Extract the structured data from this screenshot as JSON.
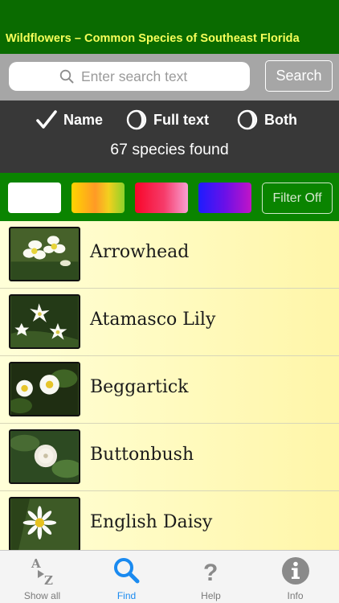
{
  "header": {
    "title": "Wildflowers – Common Species of Southeast Florida"
  },
  "search": {
    "placeholder": "Enter search text",
    "value": "",
    "button_label": "Search"
  },
  "options": {
    "items": [
      {
        "label": "Name",
        "selected": true
      },
      {
        "label": "Full text",
        "selected": false
      },
      {
        "label": "Both",
        "selected": false
      }
    ],
    "result_count": "67 species found"
  },
  "filter": {
    "swatches": [
      {
        "name": "white",
        "colors": [
          "#ffffff"
        ]
      },
      {
        "name": "yellow-orange",
        "colors": [
          "#ffd400",
          "#ff9a26",
          "#8dd12a"
        ]
      },
      {
        "name": "red-pink",
        "colors": [
          "#f8062a",
          "#f8a0d2"
        ]
      },
      {
        "name": "blue-purple",
        "colors": [
          "#1d1cff",
          "#c214c6"
        ]
      }
    ],
    "button_label": "Filter Off"
  },
  "species": [
    {
      "name": "Arrowhead",
      "thumbnail": "arrowhead-photo"
    },
    {
      "name": "Atamasco Lily",
      "thumbnail": "atamasco-lily-photo"
    },
    {
      "name": "Beggartick",
      "thumbnail": "beggartick-photo"
    },
    {
      "name": "Buttonbush",
      "thumbnail": "buttonbush-photo"
    },
    {
      "name": "English Daisy",
      "thumbnail": "english-daisy-photo"
    }
  ],
  "tabs": [
    {
      "label": "Show all",
      "icon": "a-z-sort-icon",
      "active": false
    },
    {
      "label": "Find",
      "icon": "magnifier-icon",
      "active": true
    },
    {
      "label": "Help",
      "icon": "question-mark-icon",
      "active": false
    },
    {
      "label": "Info",
      "icon": "info-circle-icon",
      "active": false
    }
  ],
  "colors": {
    "header_green": "#0a6b00",
    "title_yellow": "#f6ff5a",
    "filter_green": "#0a8400",
    "active_tab_blue": "#1a8af0",
    "row_yellow": "#fff6a8"
  }
}
